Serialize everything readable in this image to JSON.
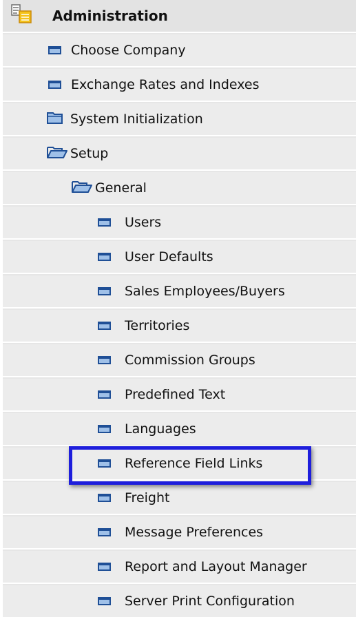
{
  "menu": {
    "header": "Administration",
    "items": [
      {
        "label": "Choose Company",
        "icon": "document-icon"
      },
      {
        "label": "Exchange Rates and Indexes",
        "icon": "document-icon"
      },
      {
        "label": "System Initialization",
        "icon": "folder-closed-icon"
      },
      {
        "label": "Setup",
        "icon": "folder-open-icon"
      },
      {
        "label": "General",
        "icon": "folder-open-icon"
      },
      {
        "label": "Users",
        "icon": "document-icon"
      },
      {
        "label": "User Defaults",
        "icon": "document-icon"
      },
      {
        "label": "Sales Employees/Buyers",
        "icon": "document-icon"
      },
      {
        "label": "Territories",
        "icon": "document-icon"
      },
      {
        "label": "Commission Groups",
        "icon": "document-icon"
      },
      {
        "label": "Predefined Text",
        "icon": "document-icon"
      },
      {
        "label": "Languages",
        "icon": "document-icon"
      },
      {
        "label": "Reference Field Links",
        "icon": "document-icon",
        "highlighted": true
      },
      {
        "label": "Freight",
        "icon": "document-icon"
      },
      {
        "label": "Message Preferences",
        "icon": "document-icon"
      },
      {
        "label": "Report and Layout Manager",
        "icon": "document-icon"
      },
      {
        "label": "Server Print Configuration",
        "icon": "document-icon"
      }
    ]
  },
  "colors": {
    "highlight_border": "#1e1edc",
    "icon_fill": "#9fc0e8",
    "icon_border": "#1f4f96",
    "folder_yellow": "#f4c21b"
  }
}
